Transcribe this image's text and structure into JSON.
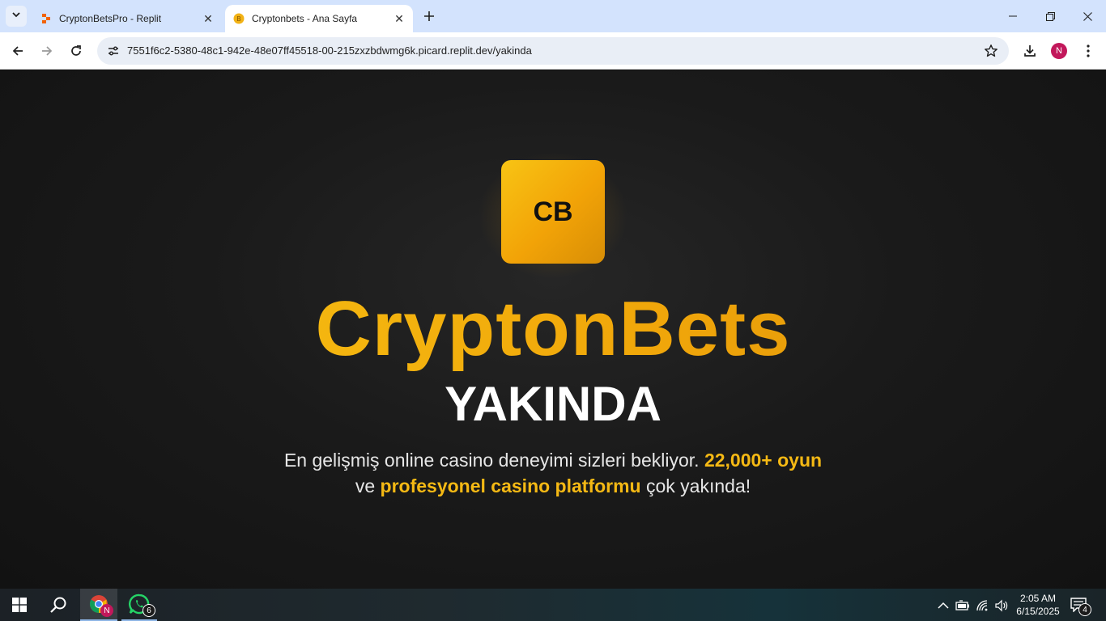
{
  "browser": {
    "tabs": [
      {
        "title": "CryptonBetsPro - Replit",
        "favicon": "replit-icon",
        "active": false
      },
      {
        "title": "Cryptonbets - Ana Sayfa",
        "favicon": "coin-icon",
        "active": true
      }
    ],
    "url": "7551f6c2-5380-48c1-942e-48e07ff45518-00-215zxzbdwmg6k.picard.replit.dev/yakinda",
    "profile_initial": "N"
  },
  "page": {
    "logo_text": "CB",
    "brand": "CryptonBets",
    "headline": "YAKINDA",
    "description": {
      "part1": "En gelişmiş online casino deneyimi sizleri bekliyor. ",
      "highlight1": "22,000+ oyun",
      "part2": " ve ",
      "highlight2": "profesyonel casino platformu",
      "part3": " çok yakında!"
    },
    "colors": {
      "accent": "#f5b914",
      "accent_dark": "#d98e08",
      "background": "#1a1a1a",
      "text": "#ffffff"
    }
  },
  "taskbar": {
    "chrome_badge": "N",
    "whatsapp_badge": "6",
    "time": "2:05 AM",
    "date": "6/15/2025",
    "notification_count": "4"
  }
}
